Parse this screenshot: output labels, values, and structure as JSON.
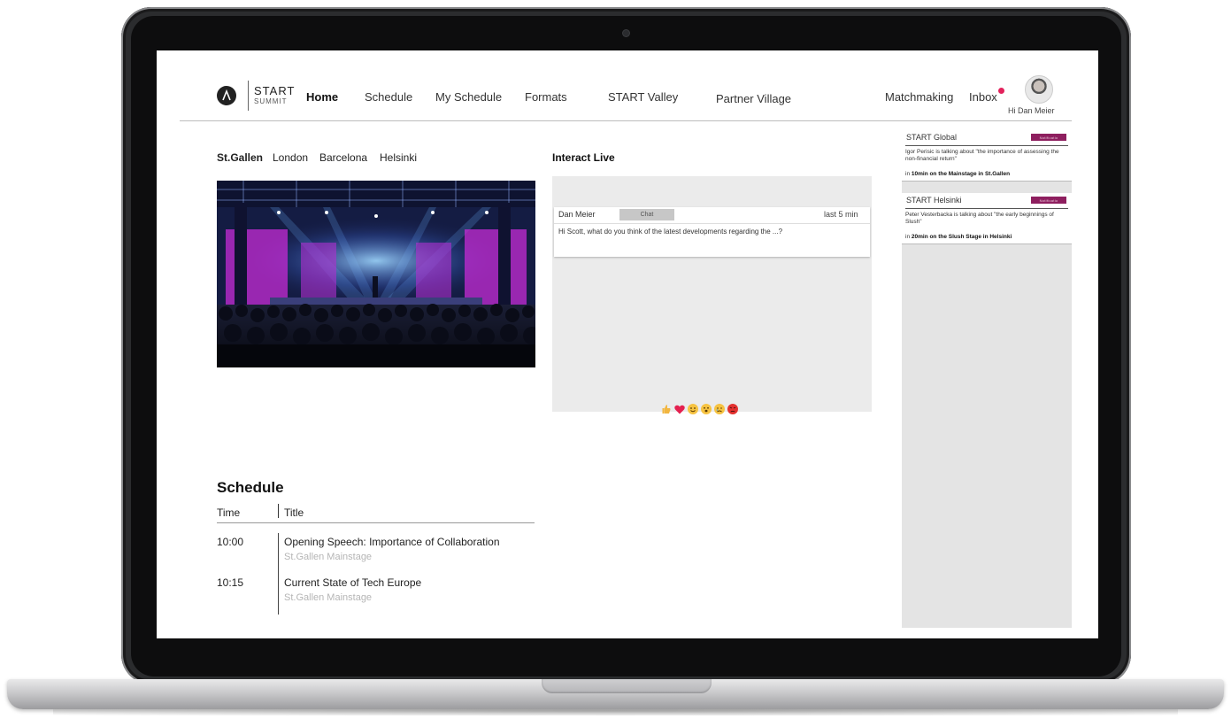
{
  "brand": {
    "name": "START",
    "sub": "SUMMIT"
  },
  "nav": {
    "items": [
      "Home",
      "Schedule",
      "My Schedule",
      "Formats",
      "START Valley",
      "Partner Village",
      "Matchmaking",
      "Inbox"
    ],
    "active": "Home",
    "greeting": "Hi Dan Meier",
    "inbox_dot_color": "#e3225c"
  },
  "cities": {
    "items": [
      "St.Gallen",
      "London",
      "Barcelona",
      "Helsinki"
    ],
    "active": "St.Gallen"
  },
  "interact": {
    "title": "Interact Live",
    "message": {
      "author": "Dan Meier",
      "badge": "Chat",
      "time": "last 5 min",
      "text": "Hi Scott, what do you think of the latest developments regarding the ...?"
    },
    "reactions": [
      "thumbs-up-icon",
      "heart-icon",
      "smile-icon",
      "laugh-icon",
      "cry-icon",
      "angry-icon"
    ]
  },
  "sidebar": {
    "cards": [
      {
        "title": "START Global",
        "badge": "Notificatio",
        "text": "Igor Perisic is talking about \"the importance of assessing the non-financial return\"",
        "in": "in",
        "when": "10min on the Mainstage in St.Gallen"
      },
      {
        "title": "START Helsinki",
        "badge": "Notificatio",
        "text": "Peter Vesterbacka is talking about \"the early beginnings of Slush\"",
        "in": "in",
        "when": "20min on the Slush Stage in Helsinki"
      }
    ]
  },
  "schedule": {
    "title": "Schedule",
    "headers": [
      "Time",
      "Title"
    ],
    "rows": [
      {
        "time": "10:00",
        "title": "Opening Speech: Importance of Collaboration",
        "location": "St.Gallen Mainstage"
      },
      {
        "time": "10:15",
        "title": "Current State of Tech Europe",
        "location": "St.Gallen Mainstage"
      }
    ]
  },
  "colors": {
    "accent": "#8e1f5f",
    "inbox_dot": "#e3225c",
    "panel": "#ebebeb",
    "sidebar": "#e4e4e4"
  }
}
